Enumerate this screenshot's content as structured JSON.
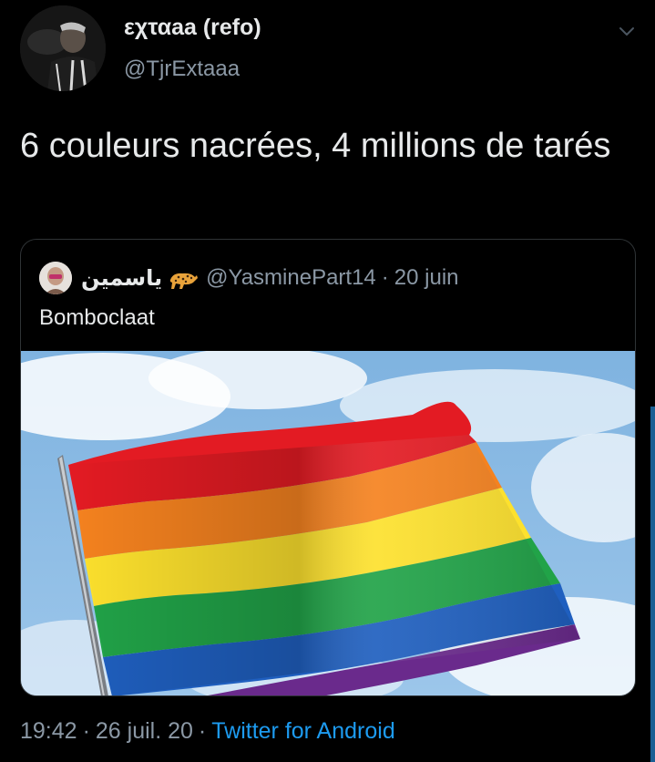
{
  "tweet": {
    "display_name": "εχταaa (refo)",
    "handle": "@TjrExtaaa",
    "text": "6 couleurs nacrées, 4 millions de tarés",
    "time": "19:42",
    "date": "26 juil. 20",
    "separator": "·",
    "source": "Twitter for Android"
  },
  "quoted_tweet": {
    "display_name": "ياسمين",
    "emoji": "leopard-emoji",
    "handle": "@YasminePart14",
    "separator": "·",
    "date": "20 juin",
    "text": "Bomboclaat",
    "image": "rainbow-flag-photo"
  },
  "icons": {
    "menu": "chevron-down-icon"
  },
  "colors": {
    "background": "#000000",
    "text_primary": "#e7e9ea",
    "text_secondary": "#8b98a5",
    "link": "#1d9bf0",
    "border": "#2f3336"
  }
}
